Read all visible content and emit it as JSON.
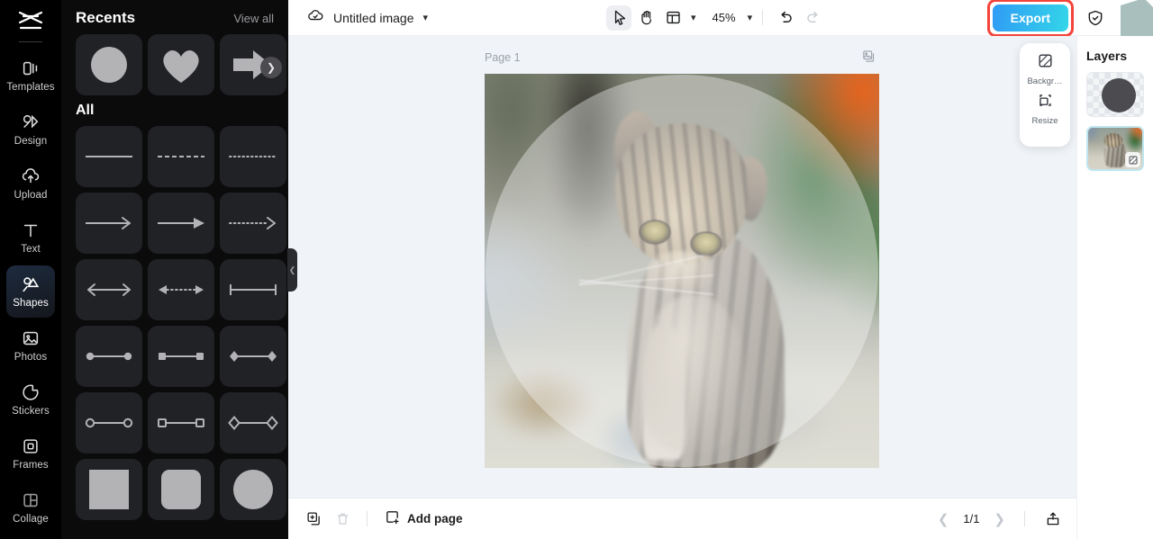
{
  "rail": {
    "logo_icon": "capcut-logo-icon",
    "items": [
      {
        "label": "Templates",
        "icon": "templates-icon",
        "active": false
      },
      {
        "label": "Design",
        "icon": "design-icon",
        "active": false
      },
      {
        "label": "Upload",
        "icon": "upload-icon",
        "active": false
      },
      {
        "label": "Text",
        "icon": "text-icon",
        "active": false
      },
      {
        "label": "Shapes",
        "icon": "shapes-icon",
        "active": true
      },
      {
        "label": "Photos",
        "icon": "photos-icon",
        "active": false
      },
      {
        "label": "Stickers",
        "icon": "stickers-icon",
        "active": false
      },
      {
        "label": "Frames",
        "icon": "frames-icon",
        "active": false
      },
      {
        "label": "Collage",
        "icon": "collage-icon",
        "active": false
      }
    ]
  },
  "panel": {
    "recents_title": "Recents",
    "view_all_label": "View all",
    "next_icon": "chevron-right-icon",
    "all_title": "All",
    "recents": [
      "circle",
      "heart",
      "block-arrow"
    ],
    "all_shapes": [
      "solid-line",
      "dashed-line",
      "dotted-line",
      "thin-arrow",
      "solid-arrow",
      "dotted-arrow",
      "double-arrow",
      "dotted-double-arrow",
      "bar-line",
      "dot-line-dot",
      "square-line-square",
      "diamond-line-diamond",
      "circle-outline-line",
      "square-outline-line",
      "diamond-outline-line",
      "square",
      "rounded-square",
      "circle"
    ],
    "collapse_icon": "chevron-left-icon"
  },
  "topbar": {
    "cloud_icon": "cloud-saved-icon",
    "doc_title": "Untitled image",
    "doc_dropdown_icon": "chevron-down-icon",
    "tools": [
      {
        "name": "select-tool",
        "icon": "cursor-arrow-icon",
        "active": true
      },
      {
        "name": "hand-tool",
        "icon": "hand-icon",
        "active": false
      },
      {
        "name": "layout-tool",
        "icon": "layout-icon",
        "active": false
      }
    ],
    "layout_dropdown_icon": "chevron-down-icon",
    "zoom_value": "45%",
    "zoom_dropdown_icon": "chevron-down-icon",
    "undo_icon": "undo-icon",
    "redo_icon": "redo-icon",
    "export_label": "Export",
    "shield_icon": "shield-check-icon",
    "avatar_icon": "avatar",
    "highlight_color": "#f4433a",
    "export_gradient_from": "#2f9bf5",
    "export_gradient_to": "#33d6e8"
  },
  "canvas": {
    "page_label": "Page 1",
    "page_options_icon": "duplicate-page-icon",
    "background_color": "#f0f3f7"
  },
  "floatcard": {
    "items": [
      {
        "label": "Backgr…",
        "icon": "background-icon"
      },
      {
        "label": "Resize",
        "icon": "resize-icon"
      }
    ]
  },
  "layers": {
    "title": "Layers",
    "items": [
      {
        "name": "circle-shape-layer",
        "icon": "circle-shape-thumb",
        "selected": false
      },
      {
        "name": "kitten-image-layer",
        "icon": "image-thumb",
        "selected": true,
        "badge_icon": "mask-icon"
      }
    ]
  },
  "bottombar": {
    "duplicate_icon": "duplicate-icon",
    "delete_icon": "trash-icon",
    "add_page_icon": "add-page-icon",
    "add_page_label": "Add page",
    "prev_icon": "chevron-left-icon",
    "page_count": "1/1",
    "next_icon": "chevron-right-icon",
    "export_icon": "export-upload-icon"
  }
}
